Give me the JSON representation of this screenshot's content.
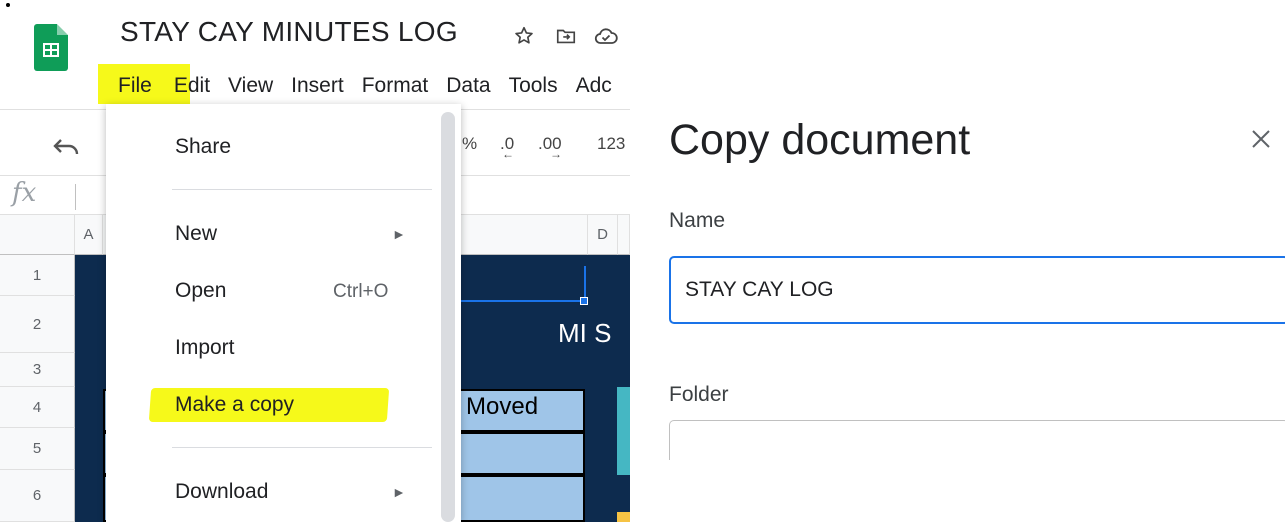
{
  "app": {
    "doc_title": "STAY CAY MINUTES LOG",
    "icons": [
      "star-icon",
      "move-folder-icon",
      "cloud-saved-icon",
      "sheets-logo-icon"
    ]
  },
  "menubar": {
    "items": [
      "File",
      "Edit",
      "View",
      "Insert",
      "Format",
      "Data",
      "Tools",
      "Adc"
    ]
  },
  "toolbar": {
    "percent": "%",
    "decrease_decimal": ".0",
    "increase_decimal": ".00",
    "more_formats": "123"
  },
  "formula_bar": {
    "fx": "fx"
  },
  "grid": {
    "columns": [
      "A",
      "D"
    ],
    "rows": [
      "1",
      "2",
      "3",
      "4",
      "5",
      "6"
    ],
    "cells": {
      "title_fragment": "MI S",
      "header_fragment": "Moved"
    }
  },
  "file_menu": {
    "items": [
      {
        "label": "Share"
      },
      {
        "label": "New",
        "submenu": true
      },
      {
        "label": "Open",
        "shortcut": "Ctrl+O"
      },
      {
        "label": "Import"
      },
      {
        "label": "Make a copy",
        "highlighted": true
      },
      {
        "label": "Download",
        "submenu": true
      }
    ],
    "submenu_arrow": "►"
  },
  "copy_dialog": {
    "title": "Copy document",
    "name_label": "Name",
    "name_value": "STAY CAY LOG",
    "folder_label": "Folder"
  },
  "colors": {
    "highlight": "#f6f91a",
    "navy": "#0d2b4e",
    "light_blue": "#9fc5e8",
    "teal": "#45b7c3",
    "focus_blue": "#1a73e8",
    "sheets_green": "#0f9d58"
  }
}
